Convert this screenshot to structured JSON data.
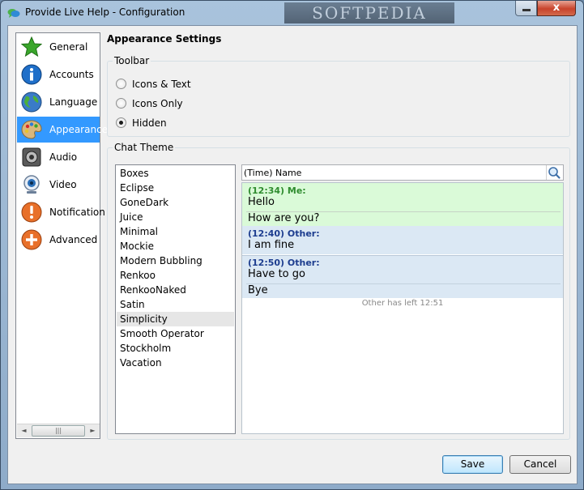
{
  "window": {
    "title": "Provide Live Help - Configuration",
    "watermark": "SOFTPEDIA",
    "close_glyph": "x",
    "minimize_icon": "minimize-icon",
    "close_icon": "close-icon"
  },
  "sidebar": {
    "items": [
      {
        "label": "General",
        "icon": "star-icon",
        "color": "#3aa62b"
      },
      {
        "label": "Accounts",
        "icon": "info-icon",
        "color": "#1f6fc9"
      },
      {
        "label": "Language",
        "icon": "globe-icon",
        "color": "#3e8f3a"
      },
      {
        "label": "Appearance",
        "icon": "palette-icon",
        "color": "#c9a86a"
      },
      {
        "label": "Audio",
        "icon": "speaker-icon",
        "color": "#444444"
      },
      {
        "label": "Video",
        "icon": "webcam-icon",
        "color": "#2a6fb8"
      },
      {
        "label": "Notification",
        "icon": "alert-icon",
        "color": "#e8702a"
      },
      {
        "label": "Advanced",
        "icon": "plus-icon",
        "color": "#e8702a"
      }
    ],
    "selected": "Appearance",
    "scroll_left": "◄",
    "scroll_right": "►",
    "scroll_grip": "|||"
  },
  "appearance": {
    "title": "Appearance Settings",
    "toolbar_group": "Toolbar",
    "toolbar_options": [
      "Icons & Text",
      "Icons Only",
      "Hidden"
    ],
    "toolbar_selected": "Hidden",
    "chat_theme_group": "Chat Theme",
    "themes": [
      "Boxes",
      "Eclipse",
      "GoneDark",
      "Juice",
      "Minimal",
      "Mockie",
      "Modern Bubbling",
      "Renkoo",
      "RenkooNaked",
      "Satin",
      "Simplicity",
      "Smooth Operator",
      "Stockholm",
      "Vacation"
    ],
    "theme_selected": "Simplicity",
    "search_value": "(Time) Name",
    "search_icon": "magnifier-icon"
  },
  "preview": {
    "messages": [
      {
        "header": "(12:34) Me:",
        "lines": [
          "Hello",
          "How are you?"
        ],
        "sender": "me"
      },
      {
        "header": "(12:40) Other:",
        "lines": [
          "I am fine"
        ],
        "sender": "other"
      },
      {
        "header": "(12:50) Other:",
        "lines": [
          "Have to go",
          "Bye"
        ],
        "sender": "other"
      }
    ],
    "status": "Other has left 12:51"
  },
  "buttons": {
    "save": "Save",
    "cancel": "Cancel"
  },
  "colors": {
    "selection": "#3399ff",
    "me_bg": "#dafad8",
    "other_bg": "#dbe8f4"
  }
}
